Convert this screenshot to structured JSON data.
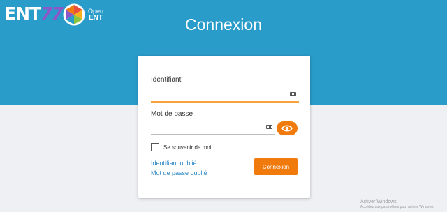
{
  "header": {
    "logo_ent": {
      "text": "ENT",
      "number": "77"
    },
    "logo_open": {
      "line1": "Open",
      "line2": "ENT"
    },
    "title": "Connexion"
  },
  "login": {
    "identifiant_label": "Identifiant",
    "identifiant_value": "",
    "password_label": "Mot de passe",
    "password_value": "",
    "remember_label": "Se souvenir de moi",
    "remember_checked": false,
    "forgot_id": "Identifiant oublié",
    "forgot_password": "Mot de passe oublié",
    "submit": "Connexion"
  },
  "colors": {
    "header_bg": "#2a9cca",
    "accent": "#f07a0c",
    "focus_underline": "#f5a33a",
    "link": "#2a86c4",
    "page_bg": "#eef0f3"
  },
  "icons": {
    "field_key": "key-icon",
    "show_password": "eye-icon"
  },
  "watermark": {
    "line1": "Activer Windows",
    "line2": "Accédez aux paramètres pour activer Windows."
  }
}
